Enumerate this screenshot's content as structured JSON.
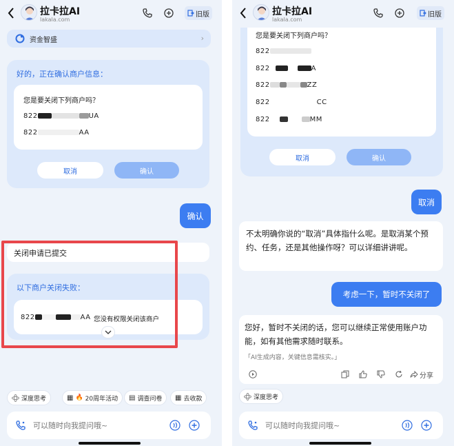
{
  "header": {
    "app_name": "拉卡拉AI",
    "domain": "lakala.com",
    "old_version_label": "旧版"
  },
  "left": {
    "fund_bar_label": "资金智盛",
    "confirm_title": "好的，正在确认商户信息：",
    "confirm_question": "您是要关闭下列商户吗？",
    "merchants": [
      {
        "prefix": "822",
        "suffix": "UA"
      },
      {
        "prefix": "822",
        "suffix": "AA"
      }
    ],
    "cancel_label": "取消",
    "confirm_label": "确认",
    "user_message": "确认",
    "submitted_text": "关闭申请已提交",
    "failed_title": "以下商户关闭失败：",
    "failed_row": {
      "prefix": "822",
      "suffix": "AA",
      "reason": "您没有权限关闭该商户"
    }
  },
  "right": {
    "confirm_question": "您是要关闭下列商户吗？",
    "merchants": [
      {
        "prefix": "822",
        "suffix": ""
      },
      {
        "prefix": "822",
        "suffix": "A"
      },
      {
        "prefix": "822",
        "suffix": "ZZ"
      },
      {
        "prefix": "822",
        "suffix": "CC"
      },
      {
        "prefix": "822",
        "suffix": "MM"
      }
    ],
    "cancel_label": "取消",
    "confirm_label": "确认",
    "user_message_1": "取消",
    "assistant_reply_1": "不太明确你说的“取消”具体指什么呢。是取消某个预约、任务，还是其他操作呀？可以详细讲讲呢。",
    "user_message_2": "考虑一下，暂时不关闭了",
    "assistant_reply_2": "您好，暂时不关闭的话，您可以继续正常使用账户功能，如有其他需求随时联系。",
    "ai_notice": "「AI生成内容，关键信息需核实。」",
    "share_label": "分享"
  },
  "quick_chips": {
    "deep_think": "深度思考",
    "anniversary": "20周年活动",
    "survey": "调查问卷",
    "collect": "去收款"
  },
  "input": {
    "placeholder": "可以随时向我提问哦~"
  },
  "colors": {
    "accent": "#3c7df1",
    "highlight_frame": "#e8474b",
    "background": "#eef3fa"
  }
}
